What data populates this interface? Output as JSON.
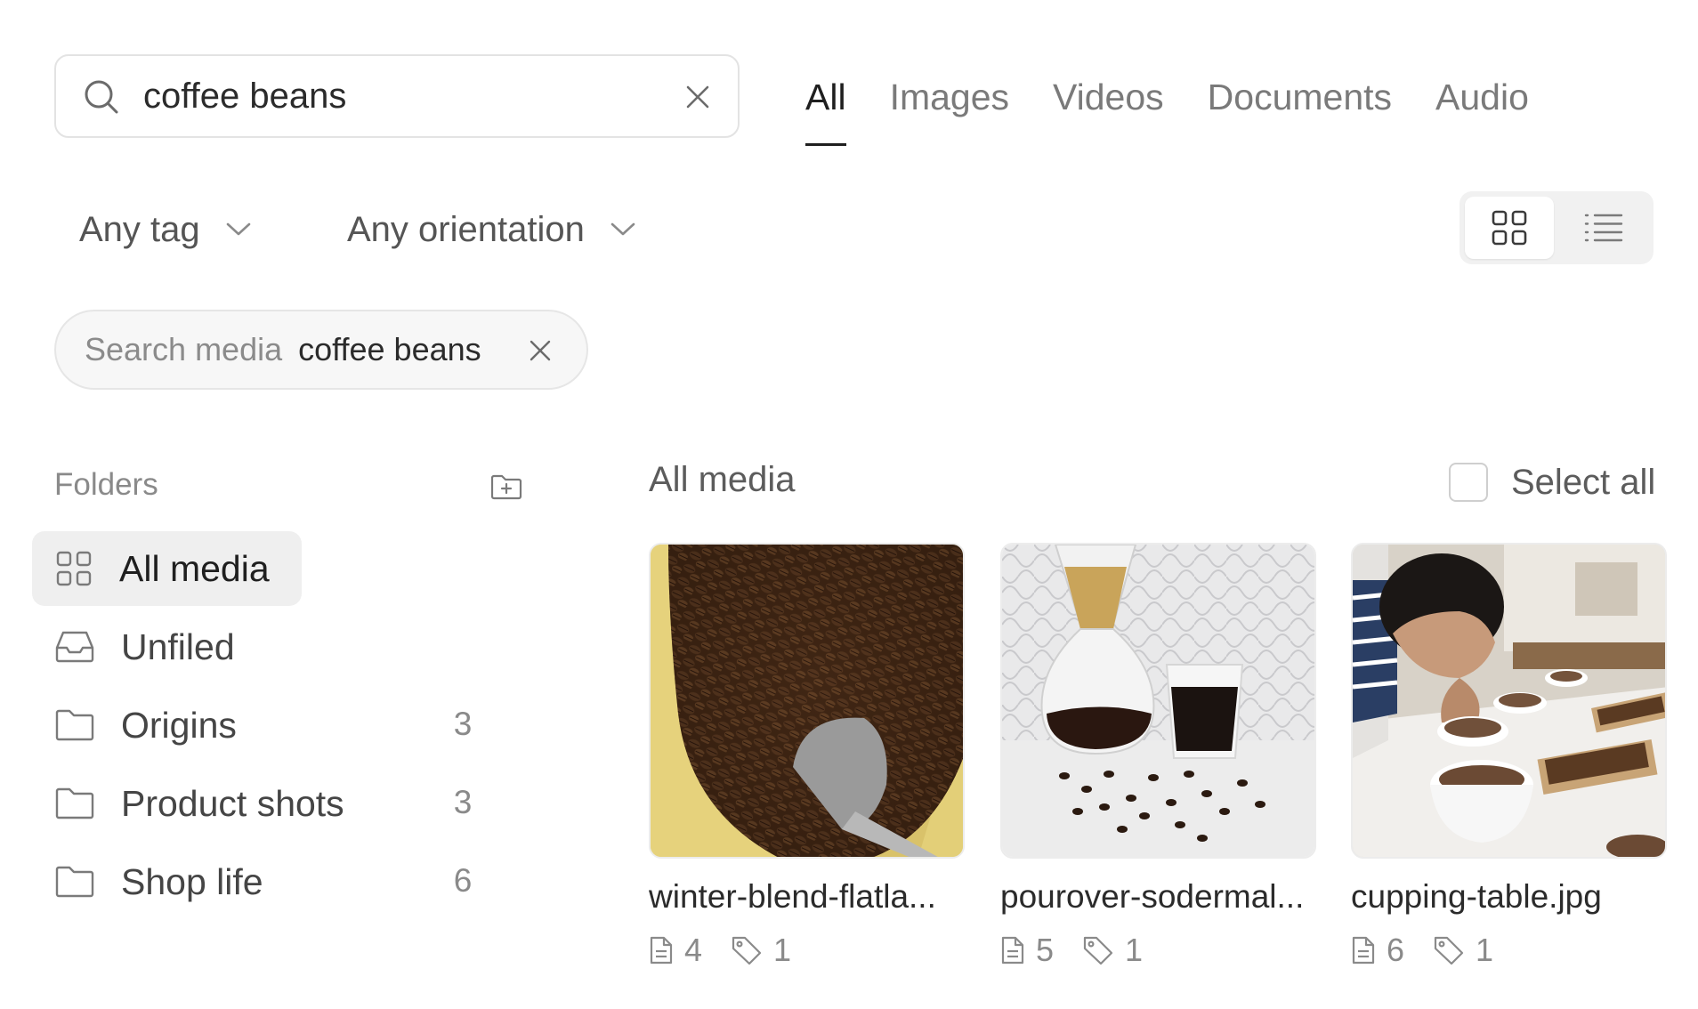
{
  "search": {
    "value": "coffee beans",
    "placeholder": "Search media"
  },
  "tabs": [
    {
      "label": "All",
      "active": true
    },
    {
      "label": "Images"
    },
    {
      "label": "Videos"
    },
    {
      "label": "Documents"
    },
    {
      "label": "Audio"
    }
  ],
  "filters": {
    "tag": "Any tag",
    "orientation": "Any orientation"
  },
  "chip": {
    "key": "Search media",
    "value": "coffee beans"
  },
  "sidebar": {
    "heading": "Folders",
    "items": [
      {
        "label": "All media"
      },
      {
        "label": "Unfiled"
      },
      {
        "label": "Origins",
        "count": "3"
      },
      {
        "label": "Product shots",
        "count": "3"
      },
      {
        "label": "Shop life",
        "count": "6"
      }
    ]
  },
  "main": {
    "title": "All media",
    "select_all": "Select all",
    "cards": [
      {
        "name": "winter-blend-flatla...",
        "notes": "4",
        "tags": "1"
      },
      {
        "name": "pourover-sodermal...",
        "notes": "5",
        "tags": "1"
      },
      {
        "name": "cupping-table.jpg",
        "notes": "6",
        "tags": "1"
      }
    ]
  },
  "colors": {
    "accent": "#1f1f1f",
    "selected_bg": "#efefef",
    "muted_text": "#8a8a8a"
  }
}
